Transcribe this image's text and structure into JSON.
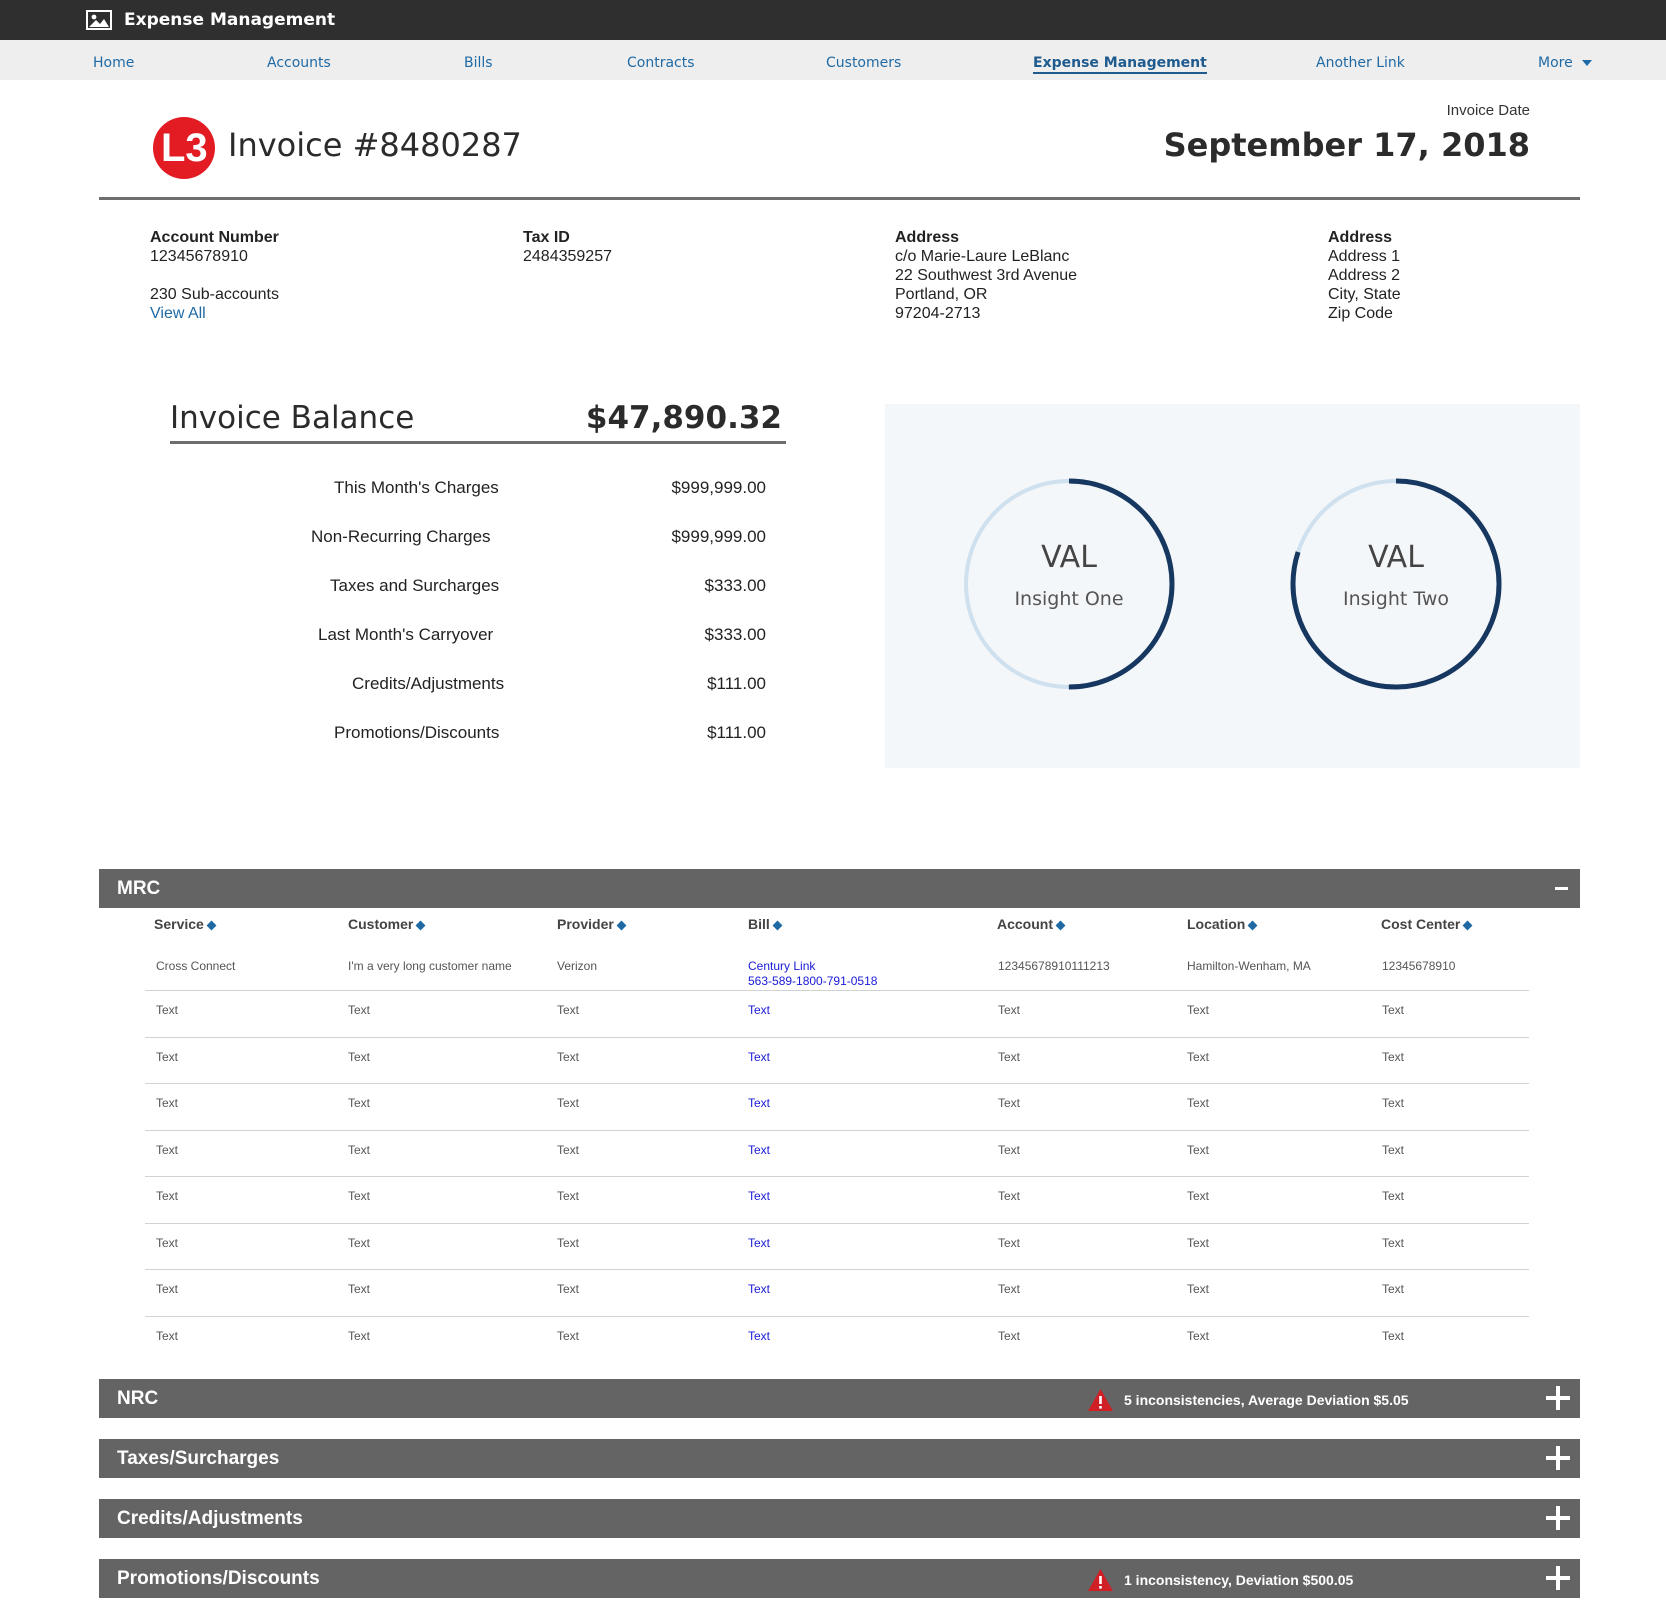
{
  "app": {
    "title": "Expense Management",
    "icon": "image-icon"
  },
  "nav": {
    "items": [
      {
        "label": "Home"
      },
      {
        "label": "Accounts"
      },
      {
        "label": "Bills"
      },
      {
        "label": "Contracts"
      },
      {
        "label": "Customers"
      },
      {
        "label": "Expense Management",
        "active": true
      },
      {
        "label": "Another Link"
      },
      {
        "label": "More"
      }
    ]
  },
  "invoice": {
    "logo_text": "L3",
    "title": "Invoice #8480287",
    "date_label": "Invoice Date",
    "date": "September 17, 2018"
  },
  "info": {
    "account": {
      "label": "Account Number",
      "value": "12345678910",
      "subaccounts": "230 Sub-accounts",
      "view_all": "View All"
    },
    "tax": {
      "label": "Tax ID",
      "value": "2484359257"
    },
    "address1": {
      "label": "Address",
      "lines": [
        "c/o Marie-Laure LeBlanc",
        "22 Southwest 3rd Avenue",
        "Portland, OR",
        "97204-2713"
      ]
    },
    "address2": {
      "label": "Address",
      "lines": [
        "Address 1",
        "Address 2",
        "City, State",
        "Zip Code"
      ]
    }
  },
  "balance": {
    "title": "Invoice Balance",
    "amount": "$47,890.32",
    "charges": [
      {
        "label": "This Month's Charges",
        "value": "$999,999.00"
      },
      {
        "label": "Non-Recurring Charges",
        "value": "$999,999.00"
      },
      {
        "label": "Taxes and Surcharges",
        "value": "$333.00"
      },
      {
        "label": "Last Month's Carryover",
        "value": "$333.00"
      },
      {
        "label": "Credits/Adjustments",
        "value": "$111.00"
      },
      {
        "label": "Promotions/Discounts",
        "value": "$111.00"
      }
    ]
  },
  "insights": [
    {
      "value": "VAL",
      "label": "Insight One",
      "fill": 0.5
    },
    {
      "value": "VAL",
      "label": "Insight Two",
      "fill": 0.8
    }
  ],
  "colors": {
    "accent": "#1f6aa5",
    "gauge_dark": "#16375f",
    "gauge_light": "#cfe0ee",
    "section_bar": "#646464",
    "warning": "#d11f26",
    "link": "#1a1ad6"
  },
  "sections": {
    "mrc": {
      "title": "MRC"
    },
    "nrc": {
      "title": "NRC",
      "warning": "5 inconsistencies, Average Deviation $5.05"
    },
    "taxes": {
      "title": "Taxes/Surcharges"
    },
    "credits": {
      "title": "Credits/Adjustments"
    },
    "promos": {
      "title": "Promotions/Discounts",
      "warning": "1 inconsistency,  Deviation $500.05"
    }
  },
  "table": {
    "columns": [
      "Service",
      "Customer",
      "Provider",
      "Bill",
      "Account",
      "Location",
      "Cost Center"
    ],
    "first_row": {
      "service": "Cross Connect",
      "customer": "I'm a very long customer name",
      "provider": "Verizon",
      "bill_line1": "Century Link",
      "bill_line2": "563-589-1800-791-0518",
      "account": "12345678910111213",
      "location": "Hamilton-Wenham, MA",
      "cost_center": "12345678910"
    },
    "rows": [
      [
        "Text",
        "Text",
        "Text",
        "Text",
        "Text",
        "Text",
        "Text"
      ],
      [
        "Text",
        "Text",
        "Text",
        "Text",
        "Text",
        "Text",
        "Text"
      ],
      [
        "Text",
        "Text",
        "Text",
        "Text",
        "Text",
        "Text",
        "Text"
      ],
      [
        "Text",
        "Text",
        "Text",
        "Text",
        "Text",
        "Text",
        "Text"
      ],
      [
        "Text",
        "Text",
        "Text",
        "Text",
        "Text",
        "Text",
        "Text"
      ],
      [
        "Text",
        "Text",
        "Text",
        "Text",
        "Text",
        "Text",
        "Text"
      ],
      [
        "Text",
        "Text",
        "Text",
        "Text",
        "Text",
        "Text",
        "Text"
      ],
      [
        "Text",
        "Text",
        "Text",
        "Text",
        "Text",
        "Text",
        "Text"
      ]
    ]
  }
}
